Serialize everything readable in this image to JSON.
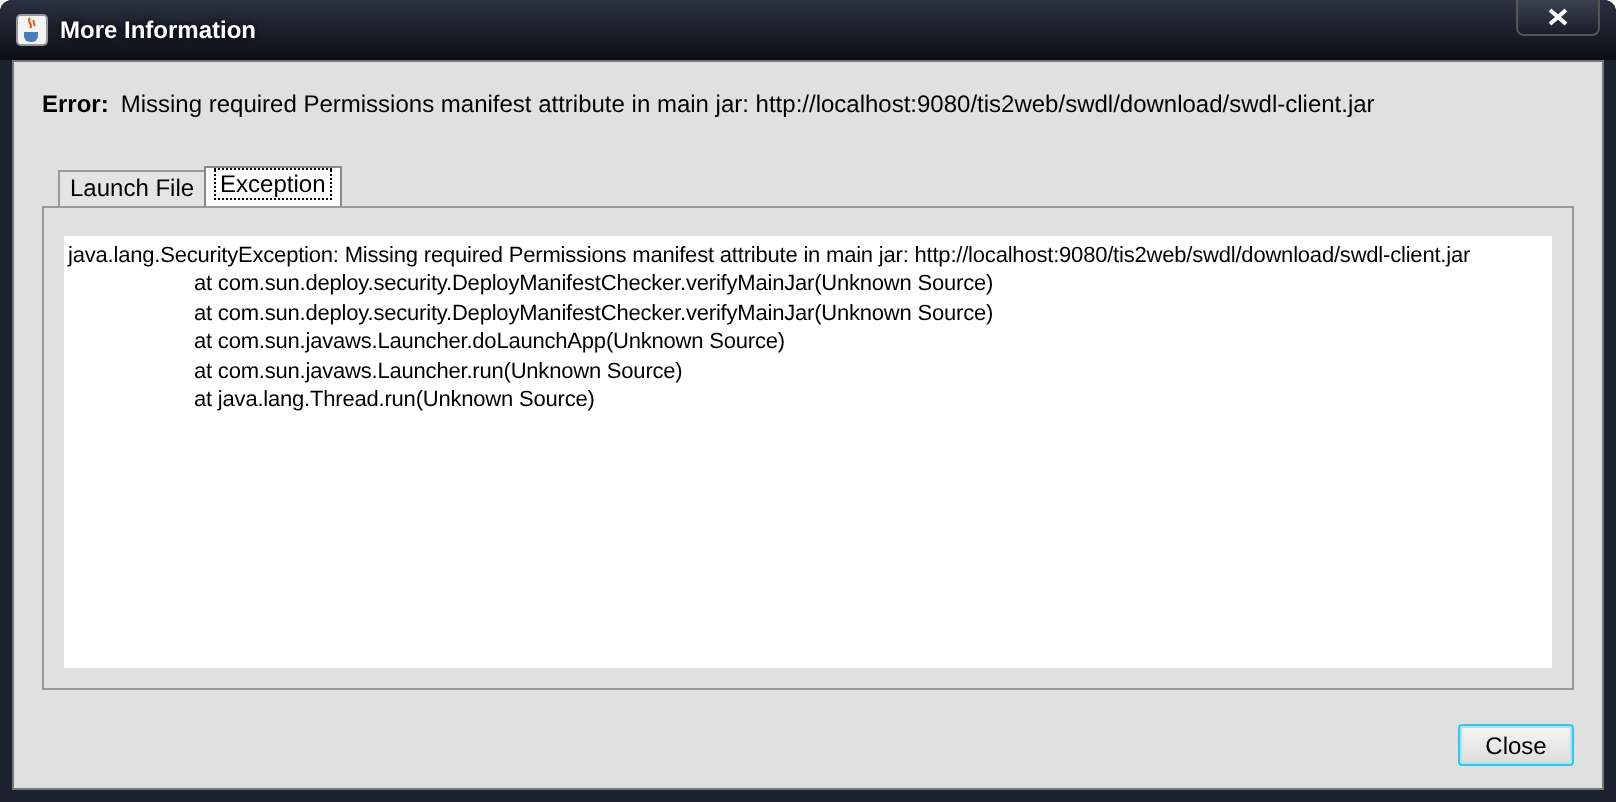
{
  "window": {
    "title": "More Information"
  },
  "error": {
    "label": "Error:",
    "message": "Missing required Permissions manifest attribute in main jar: http://localhost:9080/tis2web/swdl/download/swdl-client.jar"
  },
  "tabs": [
    {
      "label": "Launch File",
      "selected": false
    },
    {
      "label": "Exception",
      "selected": true
    }
  ],
  "trace": [
    {
      "kind": "message",
      "text": "java.lang.SecurityException: Missing required Permissions manifest attribute in main jar: http://localhost:9080/tis2web/swdl/download/swdl-client.jar"
    },
    {
      "kind": "frame",
      "text": "at com.sun.deploy.security.DeployManifestChecker.verifyMainJar(Unknown Source)"
    },
    {
      "kind": "frame",
      "text": "at com.sun.deploy.security.DeployManifestChecker.verifyMainJar(Unknown Source)"
    },
    {
      "kind": "frame",
      "text": "at com.sun.javaws.Launcher.doLaunchApp(Unknown Source)"
    },
    {
      "kind": "frame",
      "text": "at com.sun.javaws.Launcher.run(Unknown Source)"
    },
    {
      "kind": "frame",
      "text": "at java.lang.Thread.run(Unknown Source)"
    }
  ],
  "buttons": [
    {
      "label": "Close"
    }
  ]
}
